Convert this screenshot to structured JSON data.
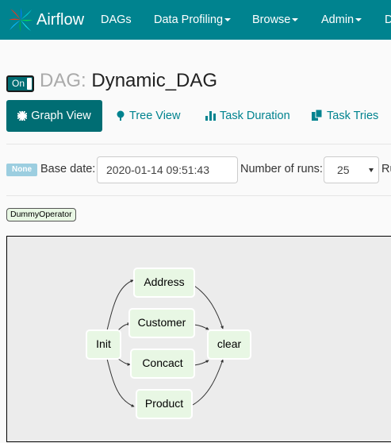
{
  "navbar": {
    "brand": "Airflow",
    "items": [
      {
        "label": "DAGs",
        "dropdown": false
      },
      {
        "label": "Data Profiling",
        "dropdown": true
      },
      {
        "label": "Browse",
        "dropdown": true
      },
      {
        "label": "Admin",
        "dropdown": true
      },
      {
        "label": "Docs",
        "dropdown": true
      }
    ]
  },
  "dag": {
    "toggle": "On",
    "prefix": "DAG:",
    "name": "Dynamic_DAG"
  },
  "tabs": [
    {
      "label": "Graph View",
      "icon": "asterisk-icon",
      "active": true
    },
    {
      "label": "Tree View",
      "icon": "tree-icon",
      "active": false
    },
    {
      "label": "Task Duration",
      "icon": "bar-chart-icon",
      "active": false
    },
    {
      "label": "Task Tries",
      "icon": "duplicate-icon",
      "active": false
    }
  ],
  "form": {
    "state_badge": "None",
    "base_date_label": "Base date:",
    "base_date_value": "2020-01-14 09:51:43",
    "num_runs_label": "Number of runs:",
    "num_runs_value": "25",
    "run_label": "Run:"
  },
  "legend": {
    "operator": "DummyOperator"
  },
  "graph": {
    "nodes": [
      "Init",
      "Address",
      "Customer",
      "Concact",
      "Product",
      "clear"
    ],
    "edges": [
      [
        "Init",
        "Address"
      ],
      [
        "Init",
        "Customer"
      ],
      [
        "Init",
        "Concact"
      ],
      [
        "Init",
        "Product"
      ],
      [
        "Address",
        "clear"
      ],
      [
        "Customer",
        "clear"
      ],
      [
        "Concact",
        "clear"
      ],
      [
        "Product",
        "clear"
      ]
    ],
    "colors": {
      "node_fill": "#e8f7e4",
      "node_border": "#ffffff",
      "background": "#ececec"
    }
  },
  "colors": {
    "navbar": "#00838f",
    "accent": "#006d73",
    "link": "#00838f"
  }
}
